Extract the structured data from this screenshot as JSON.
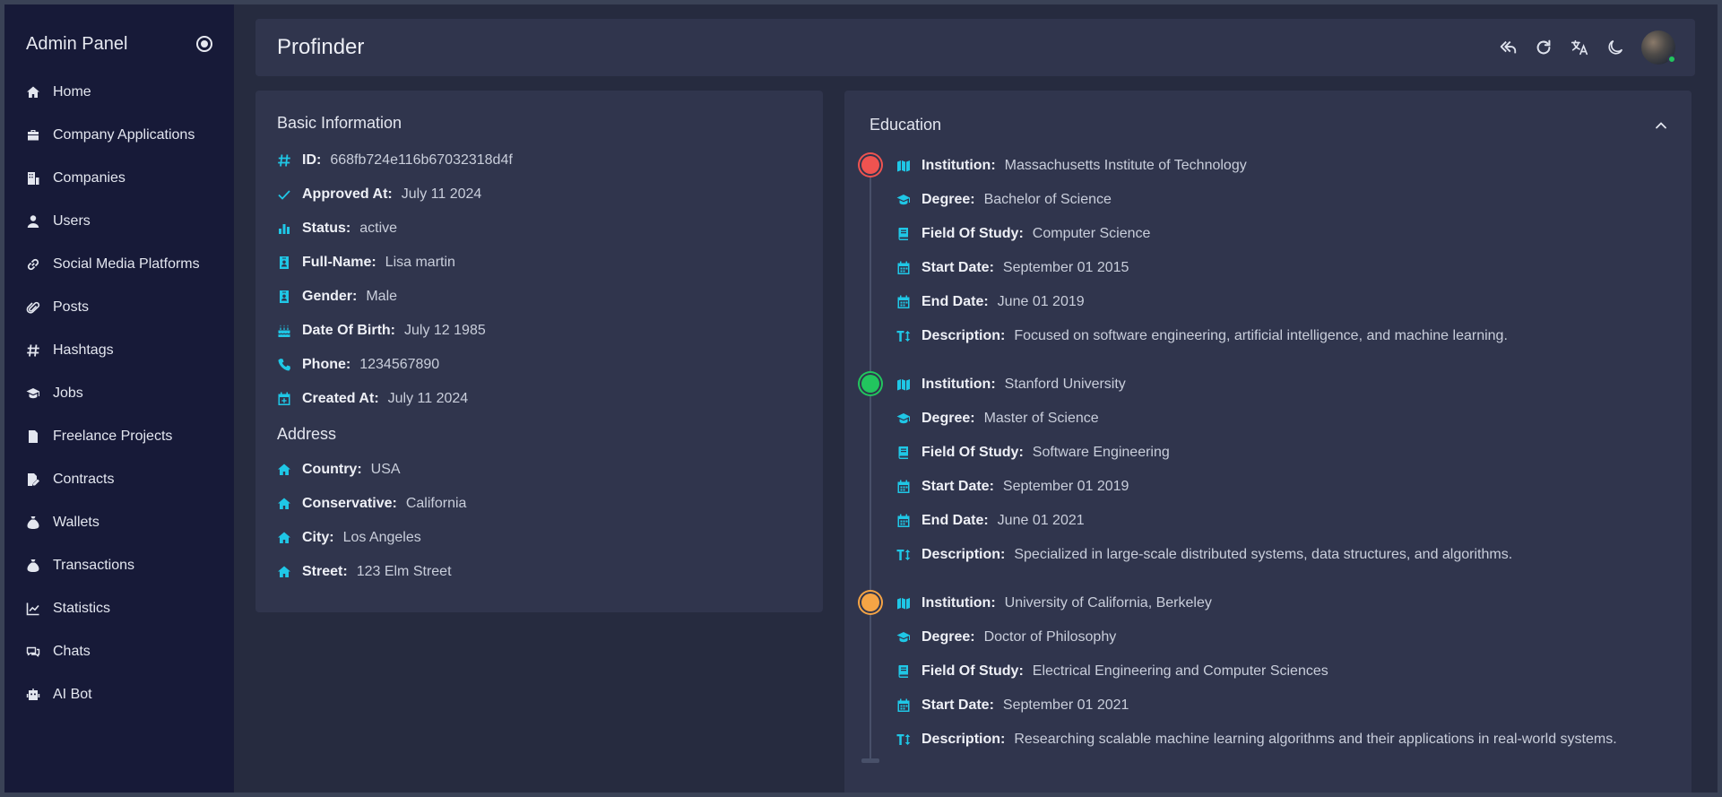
{
  "sidebar": {
    "title": "Admin Panel",
    "items": [
      {
        "label": "Home",
        "icon": "home-icon"
      },
      {
        "label": "Company Applications",
        "icon": "briefcase-icon"
      },
      {
        "label": "Companies",
        "icon": "building-icon"
      },
      {
        "label": "Users",
        "icon": "user-icon"
      },
      {
        "label": "Social Media Platforms",
        "icon": "link-icon"
      },
      {
        "label": "Posts",
        "icon": "paperclip-icon"
      },
      {
        "label": "Hashtags",
        "icon": "hashtag-icon"
      },
      {
        "label": "Jobs",
        "icon": "graduation-cap-icon"
      },
      {
        "label": "Freelance Projects",
        "icon": "file-invoice-icon"
      },
      {
        "label": "Contracts",
        "icon": "file-signature-icon"
      },
      {
        "label": "Wallets",
        "icon": "money-bag-icon"
      },
      {
        "label": "Transactions",
        "icon": "money-bag-icon"
      },
      {
        "label": "Statistics",
        "icon": "line-chart-icon"
      },
      {
        "label": "Chats",
        "icon": "chat-icon"
      },
      {
        "label": "AI Bot",
        "icon": "robot-icon"
      }
    ]
  },
  "header": {
    "title": "Profinder"
  },
  "basic": {
    "title": "Basic Information",
    "rows": [
      {
        "label": "ID:",
        "value": "668fb724e116b67032318d4f",
        "icon": "hashtag-icon"
      },
      {
        "label": "Approved At:",
        "value": "July 11 2024",
        "icon": "check-icon"
      },
      {
        "label": "Status:",
        "value": "active",
        "icon": "bar-chart-icon"
      },
      {
        "label": "Full-Name:",
        "value": "Lisa martin",
        "icon": "id-badge-icon"
      },
      {
        "label": "Gender:",
        "value": "Male",
        "icon": "id-badge-icon"
      },
      {
        "label": "Date Of Birth:",
        "value": "July 12 1985",
        "icon": "cake-icon"
      },
      {
        "label": "Phone:",
        "value": "1234567890",
        "icon": "phone-icon"
      },
      {
        "label": "Created At:",
        "value": "July 11 2024",
        "icon": "calendar-plus-icon"
      }
    ],
    "address_title": "Address",
    "address": [
      {
        "label": "Country:",
        "value": "USA"
      },
      {
        "label": "Conservative:",
        "value": "California"
      },
      {
        "label": "City:",
        "value": "Los Angeles"
      },
      {
        "label": "Street:",
        "value": "123 Elm Street"
      }
    ]
  },
  "education": {
    "title": "Education",
    "entries": [
      {
        "color": "#ef5350",
        "rows": [
          {
            "label": "Institution:",
            "value": "Massachusetts Institute of Technology",
            "icon": "map-icon"
          },
          {
            "label": "Degree:",
            "value": "Bachelor of Science",
            "icon": "graduation-cap-icon"
          },
          {
            "label": "Field Of Study:",
            "value": "Computer Science",
            "icon": "book-icon"
          },
          {
            "label": "Start Date:",
            "value": "September 01 2015",
            "icon": "calendar-icon"
          },
          {
            "label": "End Date:",
            "value": "June 01 2019",
            "icon": "calendar-icon"
          },
          {
            "label": "Description:",
            "value": "Focused on software engineering, artificial intelligence, and machine learning.",
            "icon": "text-height-icon"
          }
        ]
      },
      {
        "color": "#22c55e",
        "rows": [
          {
            "label": "Institution:",
            "value": "Stanford University",
            "icon": "map-icon"
          },
          {
            "label": "Degree:",
            "value": "Master of Science",
            "icon": "graduation-cap-icon"
          },
          {
            "label": "Field Of Study:",
            "value": "Software Engineering",
            "icon": "book-icon"
          },
          {
            "label": "Start Date:",
            "value": "September 01 2019",
            "icon": "calendar-icon"
          },
          {
            "label": "End Date:",
            "value": "June 01 2021",
            "icon": "calendar-icon"
          },
          {
            "label": "Description:",
            "value": "Specialized in large-scale distributed systems, data structures, and algorithms.",
            "icon": "text-height-icon"
          }
        ]
      },
      {
        "color": "#f5a445",
        "rows": [
          {
            "label": "Institution:",
            "value": "University of California, Berkeley",
            "icon": "map-icon"
          },
          {
            "label": "Degree:",
            "value": "Doctor of Philosophy",
            "icon": "graduation-cap-icon"
          },
          {
            "label": "Field Of Study:",
            "value": "Electrical Engineering and Computer Sciences",
            "icon": "book-icon"
          },
          {
            "label": "Start Date:",
            "value": "September 01 2021",
            "icon": "calendar-icon"
          },
          {
            "label": "Description:",
            "value": "Researching scalable machine learning algorithms and their applications in real-world systems.",
            "icon": "text-height-icon"
          }
        ]
      }
    ]
  },
  "colors": {
    "accent": "#1fc7e6",
    "sidebar_bg": "#171a38",
    "card_bg": "#30354d",
    "page_bg": "#262b3f",
    "online": "#22c55e"
  }
}
